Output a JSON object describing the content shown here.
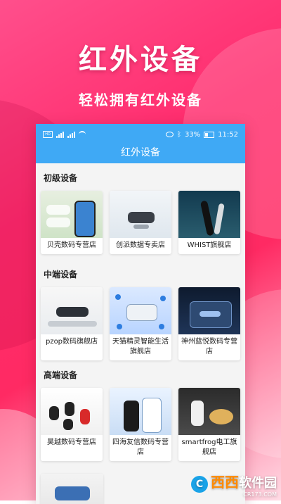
{
  "promo": {
    "title": "红外设备",
    "subtitle": "轻松拥有红外设备"
  },
  "status_bar": {
    "battery": "33%",
    "time": "11:52"
  },
  "app_bar": {
    "title": "红外设备"
  },
  "sections": [
    {
      "title": "初级设备",
      "items": [
        {
          "label": "贝壳数码专营店"
        },
        {
          "label": "创派数据专卖店"
        },
        {
          "label": "WHIST旗舰店"
        }
      ]
    },
    {
      "title": "中端设备",
      "items": [
        {
          "label": "pzop数码旗舰店"
        },
        {
          "label": "天猫精灵智能生活旗舰店"
        },
        {
          "label": "神州蓝悦数码专营店"
        }
      ]
    },
    {
      "title": "高端设备",
      "items": [
        {
          "label": "昊越数码专营店"
        },
        {
          "label": "四海友信数码专营店"
        },
        {
          "label": "smartfrog电工旗舰店"
        }
      ]
    }
  ],
  "watermark": {
    "brand": "西西",
    "name": "软件园",
    "url": "CR173.COM"
  }
}
